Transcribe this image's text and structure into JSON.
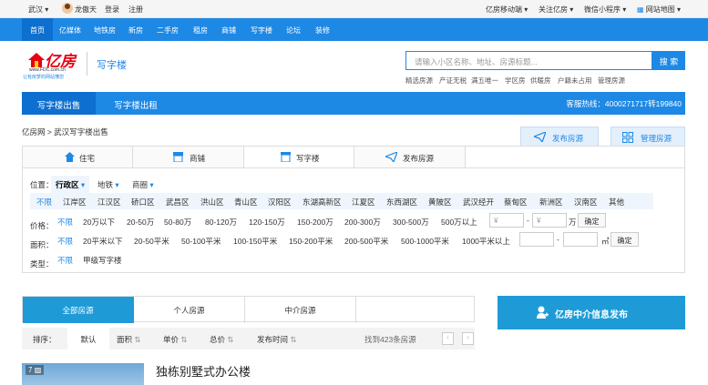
{
  "topbar": {
    "city": "武汉",
    "username": "龙傲天",
    "login": "登录",
    "register": "注册",
    "mobile": "亿房移动端",
    "follow": "关注亿房",
    "miniprogram": "微信小程序",
    "sitemap": "网站地图"
  },
  "nav": [
    "首页",
    "亿媒体",
    "地铁房",
    "新房",
    "二手房",
    "租房",
    "商铺",
    "写字楼",
    "论坛",
    "装修"
  ],
  "logo": {
    "brand": "亿房",
    "url": "www.FDC.com.cn",
    "tagline": "让有房梦的网站懂您",
    "channel": "写字楼"
  },
  "search": {
    "placeholder": "请输入小区名称、地址、房源标题...",
    "button": "搜 索"
  },
  "hot_tags": [
    "精选房源",
    "产证无税",
    "满五唯一",
    "学区房",
    "供暖房",
    "户籍未占用",
    "管理房源"
  ],
  "catbar": {
    "sale": "写字楼出售",
    "rent": "写字楼出租",
    "hotline": "客服热线：4000271717转199840"
  },
  "breadcrumb": "亿房网 > 武汉写字楼出售",
  "buttons": {
    "publish": "发布房源",
    "manage": "管理房源"
  },
  "type_tabs": [
    "住宅",
    "商铺",
    "写字楼",
    "发布房源"
  ],
  "filters": {
    "position_label": "位置：",
    "pos_tabs": [
      "行政区",
      "地铁",
      "商圈"
    ],
    "districts": [
      "不限",
      "江岸区",
      "江汉区",
      "硚口区",
      "武昌区",
      "洪山区",
      "青山区",
      "汉阳区",
      "东湖高新区",
      "江夏区",
      "东西湖区",
      "黄陂区",
      "武汉经开",
      "蔡甸区",
      "新洲区",
      "汉南区",
      "其他"
    ],
    "price_label": "价格：",
    "prices": [
      "不限",
      "20万以下",
      "20-50万",
      "50-80万",
      "80-120万",
      "120-150万",
      "150-200万",
      "200-300万",
      "300-500万",
      "500万以上"
    ],
    "price_unit_from": "¥",
    "price_unit_to": "¥",
    "price_unit": "万",
    "area_label": "面积：",
    "areas": [
      "不限",
      "20平米以下",
      "20-50平米",
      "50-100平米",
      "100-150平米",
      "150-200平米",
      "200-500平米",
      "500-1000平米",
      "1000平米以上"
    ],
    "area_unit": "㎡",
    "sep": "-",
    "confirm": "确定",
    "type_label": "类型：",
    "types": [
      "不限",
      "甲级写字楼"
    ]
  },
  "list_tabs": [
    "全部房源",
    "个人房源",
    "中介房源"
  ],
  "sort": {
    "label": "排序：",
    "options": [
      "默认",
      "面积",
      "单价",
      "总价",
      "发布时间"
    ],
    "count": "找到423条房源"
  },
  "agent_btn": "亿房中介信息发布",
  "listing": {
    "photos": "7",
    "title": "独栋别墅式办公楼"
  },
  "colors": {
    "primary": "#1e88e5",
    "logo_red": "#e60012",
    "agent": "#1e9bd7"
  }
}
